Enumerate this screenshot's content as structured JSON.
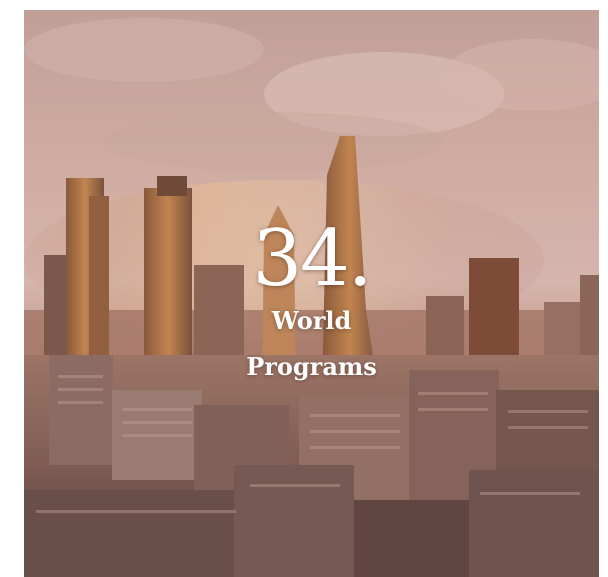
{
  "stat": {
    "number": "34.",
    "line1": "World",
    "line2": "Programs"
  }
}
